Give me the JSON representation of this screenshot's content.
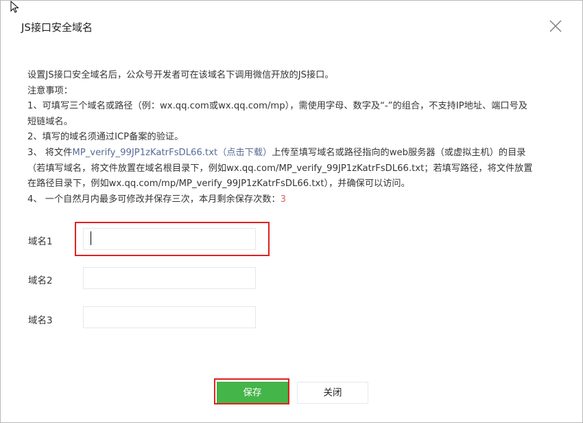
{
  "dialog": {
    "title": "JS接口安全域名",
    "close_icon": "close-icon"
  },
  "notice": {
    "intro": "设置JS接口安全域名后，公众号开发者可在该域名下调用微信开放的JS接口。",
    "heading": "注意事项：",
    "item1_line1": "1、可填写三个域名或路径（例：wx.qq.com或wx.qq.com/mp），需使用字母、数字及“-”的组合，不支持IP地址、端口号及",
    "item1_line2": "短链域名。",
    "item2": "2、填写的域名须通过ICP备案的验证。",
    "item3_prefix": "3、 将文件",
    "item3_file": "MP_verify_99JP1zKatrFsDL66.txt",
    "item3_download": "（点击下载）",
    "item3_suffix": "上传至填写域名或路径指向的web服务器（或虚拟主机）的目录",
    "item3_line2": "（若填写域名，将文件放置在域名根目录下，例如wx.qq.com/MP_verify_99JP1zKatrFsDL66.txt；若填写路径，将文件放置",
    "item3_line3": "在路径目录下，例如wx.qq.com/mp/MP_verify_99JP1zKatrFsDL66.txt），并确保可以访问。",
    "item4_prefix": "4、 一个自然月内最多可修改并保存三次，本月剩余保存次数：",
    "item4_count": "3"
  },
  "fields": [
    {
      "label": "域名1",
      "value": ""
    },
    {
      "label": "域名2",
      "value": ""
    },
    {
      "label": "域名3",
      "value": ""
    }
  ],
  "buttons": {
    "save": "保存",
    "close": "关闭"
  },
  "colors": {
    "primary": "#44b549",
    "link": "#576b95",
    "count": "#e15f63",
    "highlight": "#e02020"
  }
}
